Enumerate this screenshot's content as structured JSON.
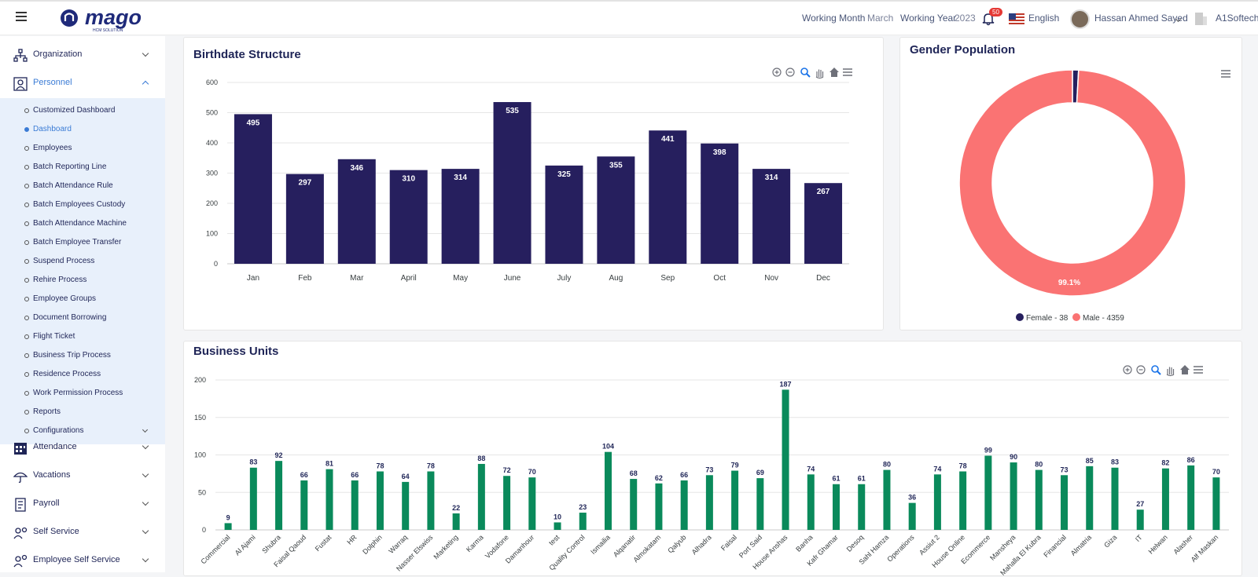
{
  "header": {
    "working_month_label": "Working Month",
    "working_month": "March",
    "working_year_label": "Working Year",
    "working_year": "2023",
    "notif_count": "50",
    "language": "English",
    "user": "Hassan Ahmed Sayed",
    "company": "A1Softech",
    "logo_text": "mago",
    "logo_sub": "HCM SOLUTION"
  },
  "sidebar": {
    "organization": "Organization",
    "personnel": "Personnel",
    "sub_items": [
      "Customized Dashboard",
      "Dashboard",
      "Employees",
      "Batch Reporting Line",
      "Batch Attendance Rule",
      "Batch Employees Custody",
      "Batch Attendance Machine",
      "Batch Employee Transfer",
      "Suspend Process",
      "Rehire Process",
      "Employee Groups",
      "Document Borrowing",
      "Flight Ticket",
      "Business Trip Process",
      "Residence Process",
      "Work Permission Process",
      "Reports",
      "Configurations"
    ],
    "active_sub": "Dashboard",
    "attendance": "Attendance",
    "vacations": "Vacations",
    "payroll": "Payroll",
    "self_service": "Self Service",
    "employee_self_service": "Employee Self Service"
  },
  "birthdate": {
    "title": "Birthdate Structure"
  },
  "gender": {
    "title": "Gender Population",
    "female_legend": "Female - 38",
    "male_legend": "Male - 4359",
    "male_pct": "99.1%"
  },
  "business": {
    "title": "Business Units"
  },
  "colors": {
    "navy": "#261f5e",
    "green": "#0a8a5b",
    "male": "#fa7373",
    "accent": "#3a7bd5"
  },
  "chart_data": [
    {
      "type": "bar",
      "title": "Birthdate Structure",
      "categories": [
        "Jan",
        "Feb",
        "Mar",
        "April",
        "May",
        "June",
        "July",
        "Aug",
        "Sep",
        "Oct",
        "Nov",
        "Dec"
      ],
      "values": [
        495,
        297,
        346,
        310,
        314,
        535,
        325,
        355,
        441,
        398,
        314,
        267
      ],
      "ylim": [
        0,
        600
      ],
      "yticks": [
        0,
        100,
        200,
        300,
        400,
        500,
        600
      ]
    },
    {
      "type": "pie",
      "title": "Gender Population",
      "slices": [
        {
          "name": "Female",
          "value": 38
        },
        {
          "name": "Male",
          "value": 4359
        }
      ]
    },
    {
      "type": "bar",
      "title": "Business Units",
      "categories": [
        "Commercial",
        "Al Ajami",
        "Shubra",
        "Faisal Qaoud",
        "Fustat",
        "HR",
        "Dolphin",
        "Warraq",
        "Nasser Elswiss",
        "Marketing",
        "Karma",
        "Vodafone",
        "Damanhour",
        "test",
        "Quality Control",
        "Ismailia",
        "Alqanatir",
        "Almokatam",
        "Qalyub",
        "Alhadra",
        "Faisal",
        "Port Said",
        "House Anshas",
        "Banha",
        "Kafr Ghamar",
        "Desoq",
        "Sahl Hamza",
        "Operations",
        "Assiut 2",
        "House Online",
        "Ecommerce",
        "Mansheya",
        "Mahalla El Kubra",
        "Financial",
        "Almatria",
        "Giza",
        "IT",
        "Helwan",
        "Alasher",
        "Alf Maskan"
      ],
      "values": [
        9,
        83,
        92,
        66,
        81,
        66,
        78,
        64,
        78,
        22,
        88,
        72,
        70,
        10,
        23,
        104,
        68,
        62,
        66,
        73,
        79,
        69,
        187,
        74,
        61,
        61,
        80,
        36,
        74,
        78,
        99,
        90,
        80,
        73,
        85,
        83,
        27,
        82,
        86,
        70
      ],
      "ylim": [
        0,
        200
      ],
      "yticks": [
        0,
        50,
        100,
        150,
        200
      ]
    }
  ]
}
